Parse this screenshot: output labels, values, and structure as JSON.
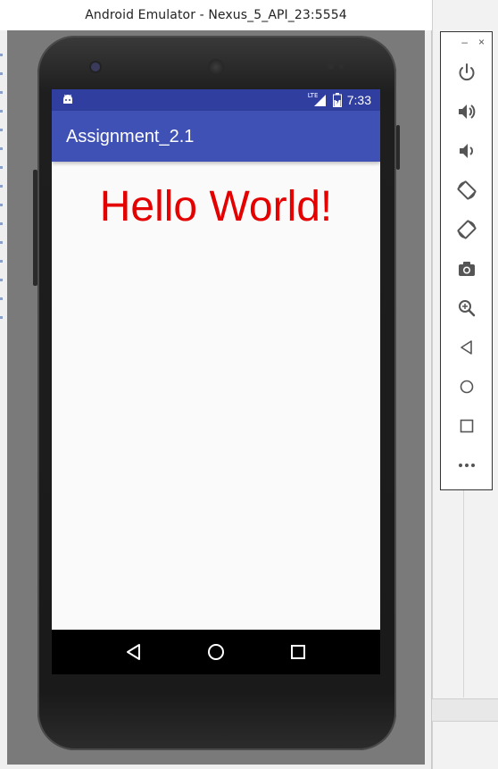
{
  "window": {
    "title": "Android Emulator - Nexus_5_API_23:5554"
  },
  "statusbar": {
    "time": "7:33",
    "network_label": "LTE",
    "icons": [
      "android-notification-icon",
      "signal-icon",
      "battery-icon"
    ]
  },
  "appbar": {
    "title": "Assignment_2.1"
  },
  "content": {
    "hello_text": "Hello World!"
  },
  "navbar": {
    "buttons": [
      "back-icon",
      "home-icon",
      "recents-icon"
    ]
  },
  "toolbar": {
    "window_controls": [
      "minimize-icon",
      "close-icon"
    ],
    "tools": [
      "power-icon",
      "volume-up-icon",
      "volume-down-icon",
      "rotate-left-icon",
      "rotate-right-icon",
      "camera-icon",
      "zoom-icon",
      "back-icon",
      "home-icon",
      "overview-icon",
      "more-icon"
    ]
  },
  "colors": {
    "statusbar": "#303f9f",
    "appbar": "#3f51b5",
    "hello_text": "#e50000",
    "toolbar_icons": "#555555"
  }
}
